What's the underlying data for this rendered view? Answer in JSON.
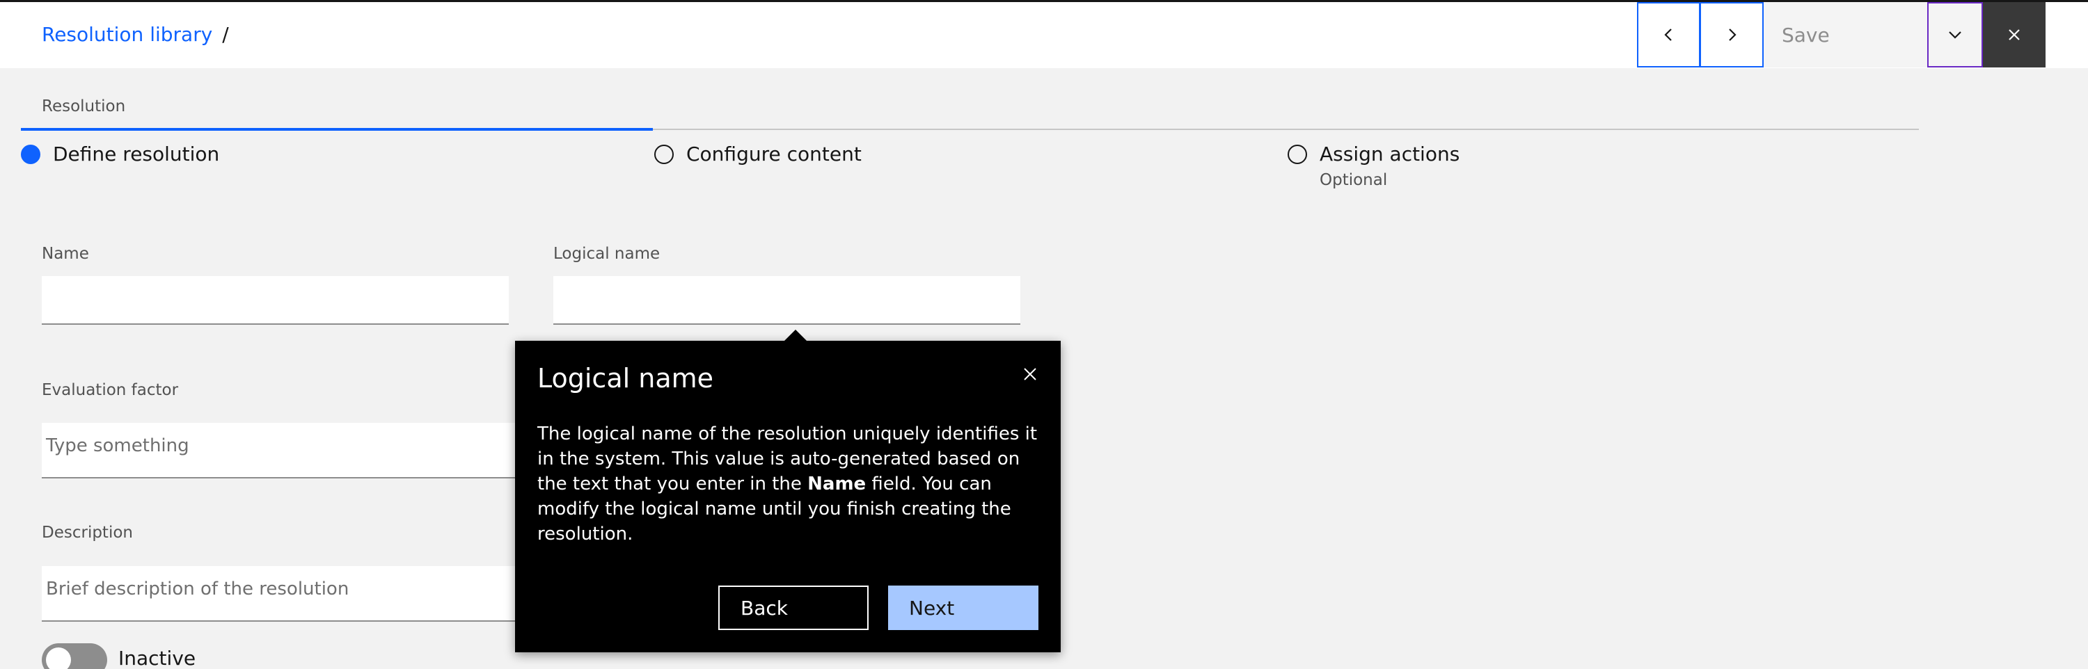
{
  "breadcrumb": {
    "link": "Resolution library",
    "separator": "/"
  },
  "toolbar": {
    "save_label": "Save"
  },
  "section_label": "Resolution",
  "steps": [
    {
      "label": "Define resolution",
      "sub": "",
      "state": "current"
    },
    {
      "label": "Configure content",
      "sub": "",
      "state": "incomplete"
    },
    {
      "label": "Assign actions",
      "sub": "Optional",
      "state": "incomplete"
    }
  ],
  "form": {
    "name": {
      "label": "Name",
      "value": "",
      "placeholder": ""
    },
    "logical_name": {
      "label": "Logical name",
      "value": "",
      "placeholder": ""
    },
    "evaluation_factor": {
      "label": "Evaluation factor",
      "value": "",
      "placeholder": "Type something"
    },
    "description": {
      "label": "Description",
      "value": "",
      "placeholder": "Brief description of the resolution"
    },
    "status_toggle": {
      "label": "Inactive",
      "on": false
    }
  },
  "popover": {
    "title": "Logical name",
    "body_part1": "The logical name of the resolution uniquely identifies it in the system. This value is auto-generated based on the text that you enter in the ",
    "body_bold": "Name",
    "body_part2": " field. You can modify the logical name until you finish creating the resolution.",
    "back_label": "Back",
    "next_label": "Next"
  },
  "colors": {
    "accent": "#0f62fe",
    "popover_bg": "#000000",
    "next_button": "#a6c8ff"
  },
  "icons": [
    "chevron-left-icon",
    "chevron-right-icon",
    "chevron-down-icon",
    "close-icon"
  ]
}
